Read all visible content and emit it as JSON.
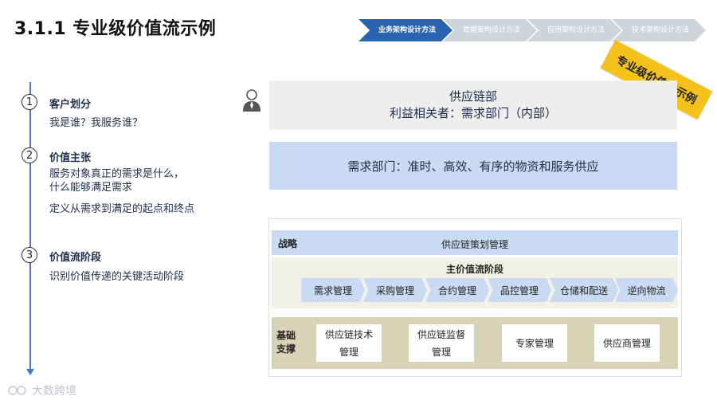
{
  "page": {
    "title": "3.1.1 专业级价值流示例"
  },
  "process_steps": [
    {
      "label": "业务架构设计方法",
      "active": true
    },
    {
      "label": "数据架构设计方法",
      "active": false
    },
    {
      "label": "应用架构设计方法",
      "active": false
    },
    {
      "label": "技术架构设计方法",
      "active": false
    }
  ],
  "stamp": {
    "label": "专业级价值流示例"
  },
  "stages": [
    {
      "number": "1",
      "title": "客户划分",
      "lines": [
        "我是谁？我服务谁？"
      ]
    },
    {
      "number": "2",
      "title": "价值主张",
      "lines": [
        "服务对象真正的需求是什么，",
        "什么能够满足需求",
        "定义从需求到满足的起点和终点"
      ]
    },
    {
      "number": "3",
      "title": "价值流阶段",
      "lines": [
        "识别价值传递的关键活动阶段"
      ]
    }
  ],
  "customer_box": {
    "line1": "供应链部",
    "line2": "利益相关者：需求部门（内部）"
  },
  "value_proposition": {
    "text": "需求部门：准时、高效、有序的物资和服务供应"
  },
  "framework": {
    "strategy_label": "战略",
    "strategy_value": "供应链策划管理",
    "main_title": "主价值流阶段",
    "main_stages": [
      "需求管理",
      "采购管理",
      "合约管理",
      "品控管理",
      "仓储和配送",
      "逆向物流"
    ],
    "support_label": "基础支撑",
    "support_items": [
      "供应链技术管理",
      "供应链监督管理",
      "专家管理",
      "供应商管理"
    ]
  },
  "colors": {
    "accent_blue": "#2a63b0",
    "light_blue": "#c9dbf2",
    "stamp_yellow": "#f4c21a",
    "support_tan": "#d8d3b7"
  },
  "watermark": {
    "text": "大数跨境"
  }
}
